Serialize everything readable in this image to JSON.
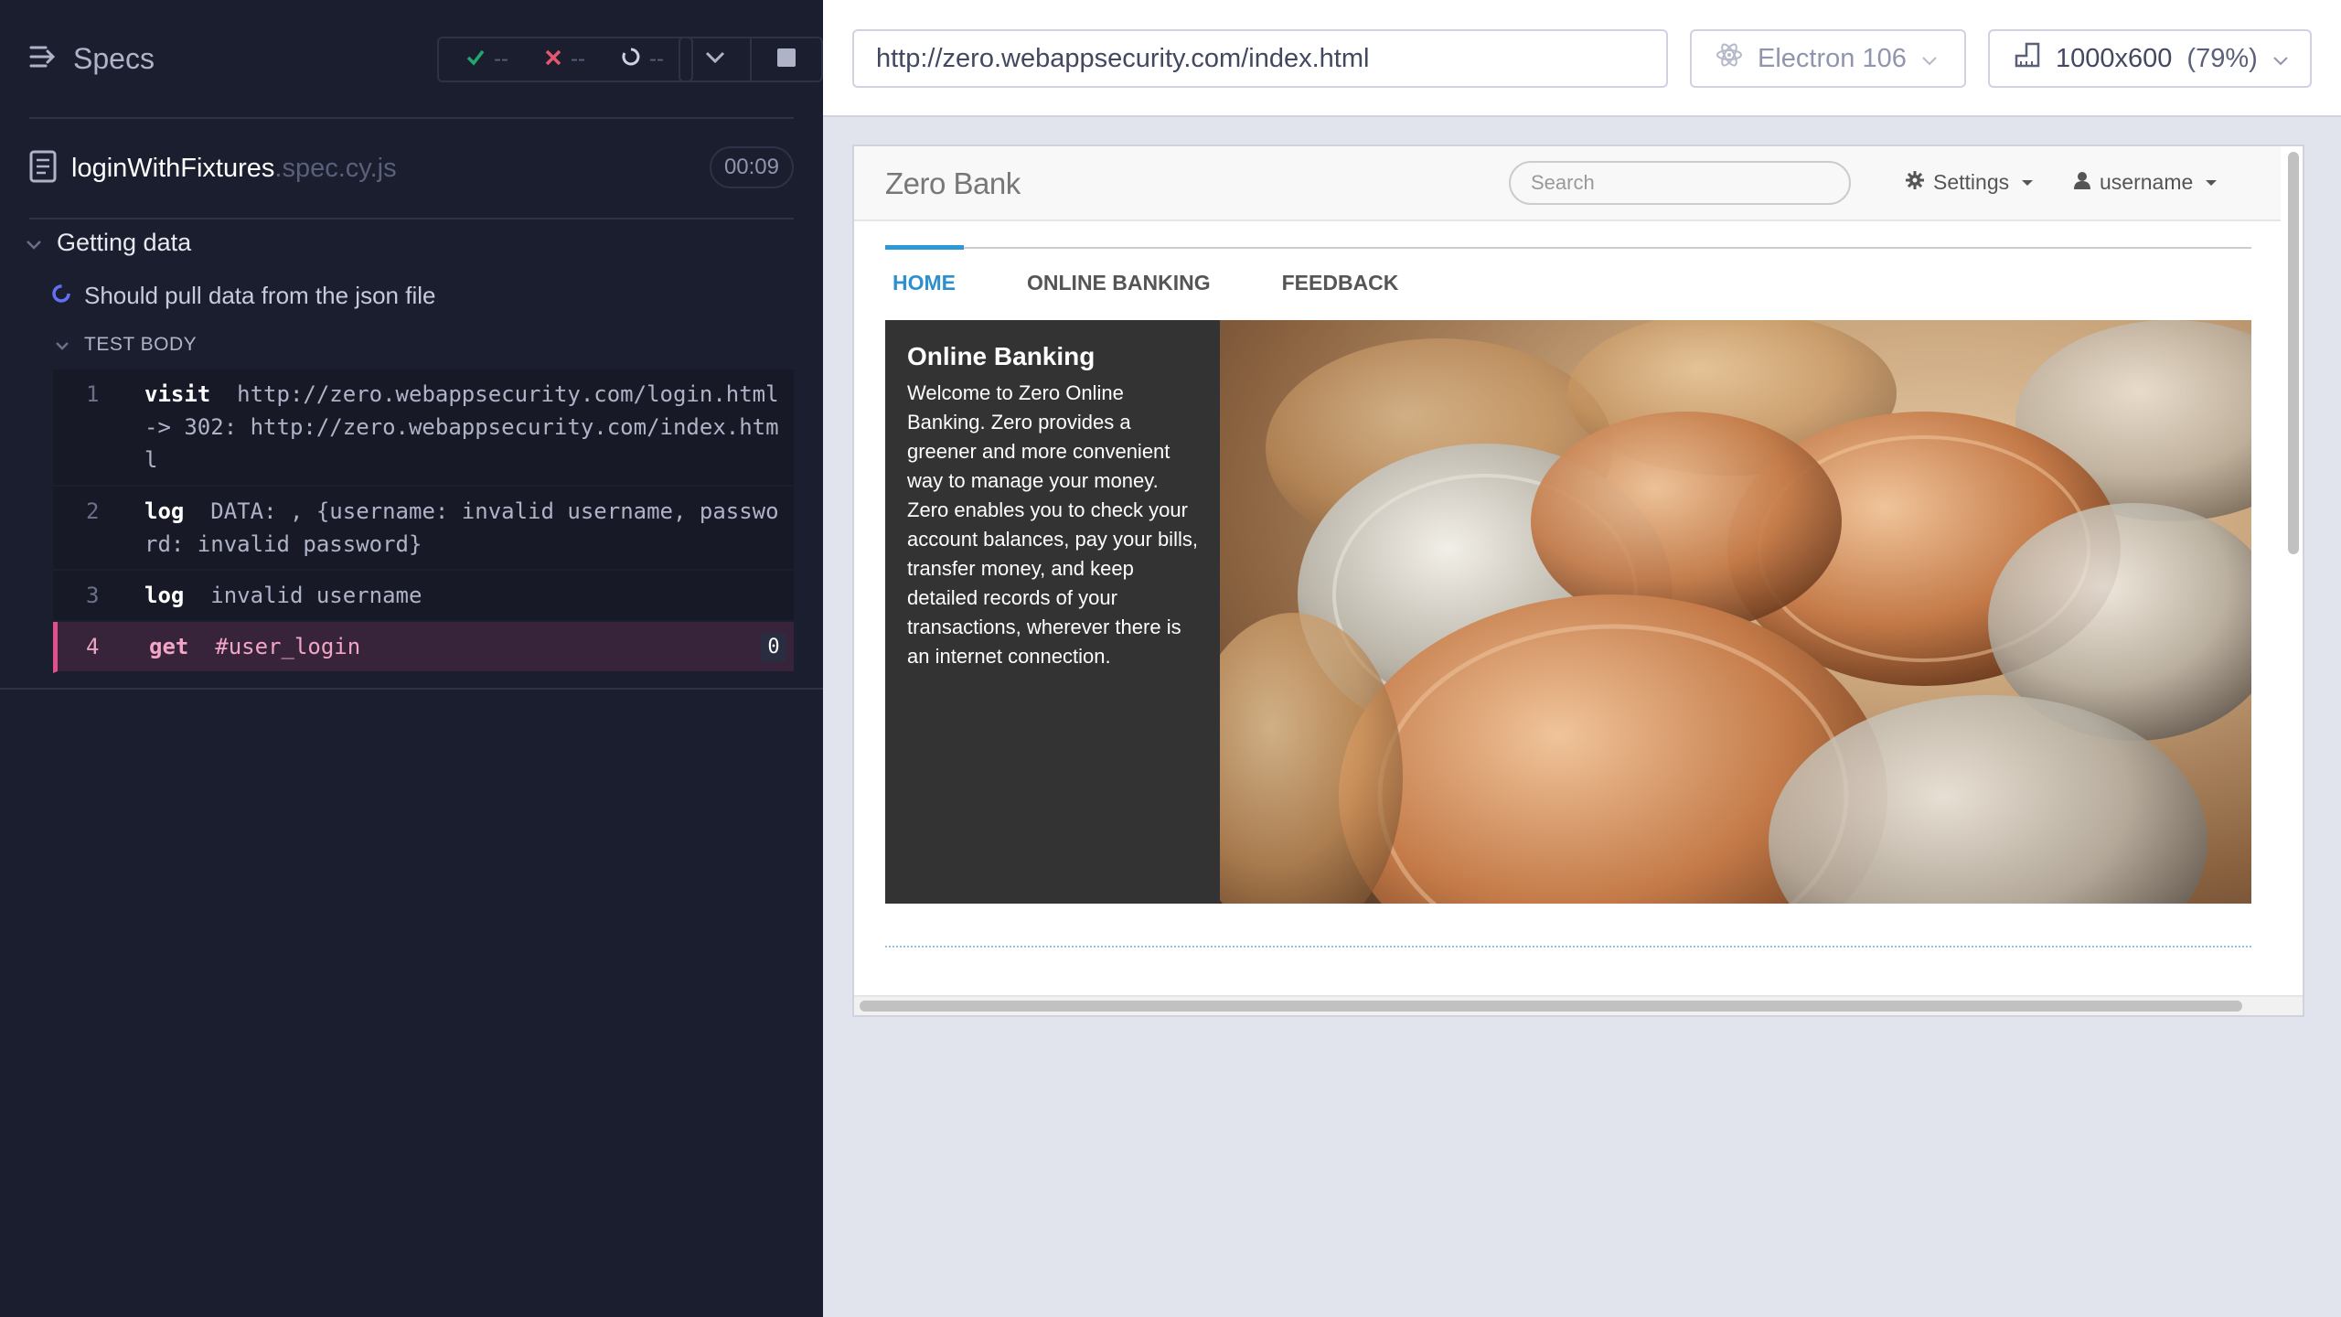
{
  "reporter": {
    "specs_label": "Specs",
    "stats": {
      "passed": "--",
      "failed": "--",
      "pending": "--"
    },
    "file": {
      "name": "loginWithFixtures",
      "ext": ".spec.cy.js",
      "duration": "00:09"
    },
    "suite": {
      "title": "Getting data"
    },
    "test": {
      "title": "Should pull data from the json file"
    },
    "section_label": "TEST BODY",
    "commands": [
      {
        "num": "1",
        "name": "visit",
        "message": "http://zero.webappsecurity.com/login.html -> 302: http://zero.webappsecurity.com/index.html"
      },
      {
        "num": "2",
        "name": "log",
        "message": "DATA: , {username: invalid username, password: invalid password}"
      },
      {
        "num": "3",
        "name": "log",
        "message": "invalid username"
      },
      {
        "num": "4",
        "name": "get",
        "message": "#user_login",
        "count": "0",
        "active": true
      }
    ],
    "colors": {
      "background": "#1b1e2e",
      "active_command": "#e0508b",
      "passed": "#1fa971",
      "failed": "#e45770"
    }
  },
  "aut": {
    "url": "http://zero.webappsecurity.com/index.html",
    "browser": "Electron 106",
    "viewport_size": "1000x600",
    "viewport_scale": "(79%)",
    "app": {
      "brand": "Zero Bank",
      "search_placeholder": "Search",
      "settings_label": "Settings",
      "user_label": "username",
      "tabs": [
        {
          "label": "HOME",
          "active": true
        },
        {
          "label": "ONLINE BANKING",
          "active": false
        },
        {
          "label": "FEEDBACK",
          "active": false
        }
      ],
      "hero": {
        "title": "Online Banking",
        "body": "Welcome to Zero Online Banking. Zero provides a greener and more convenient way to manage your money. Zero enables you to check your account balances, pay your bills, transfer money, and keep detailed records of your transactions, wherever there is an internet connection."
      },
      "colors": {
        "accent": "#2e8fcf"
      }
    }
  }
}
